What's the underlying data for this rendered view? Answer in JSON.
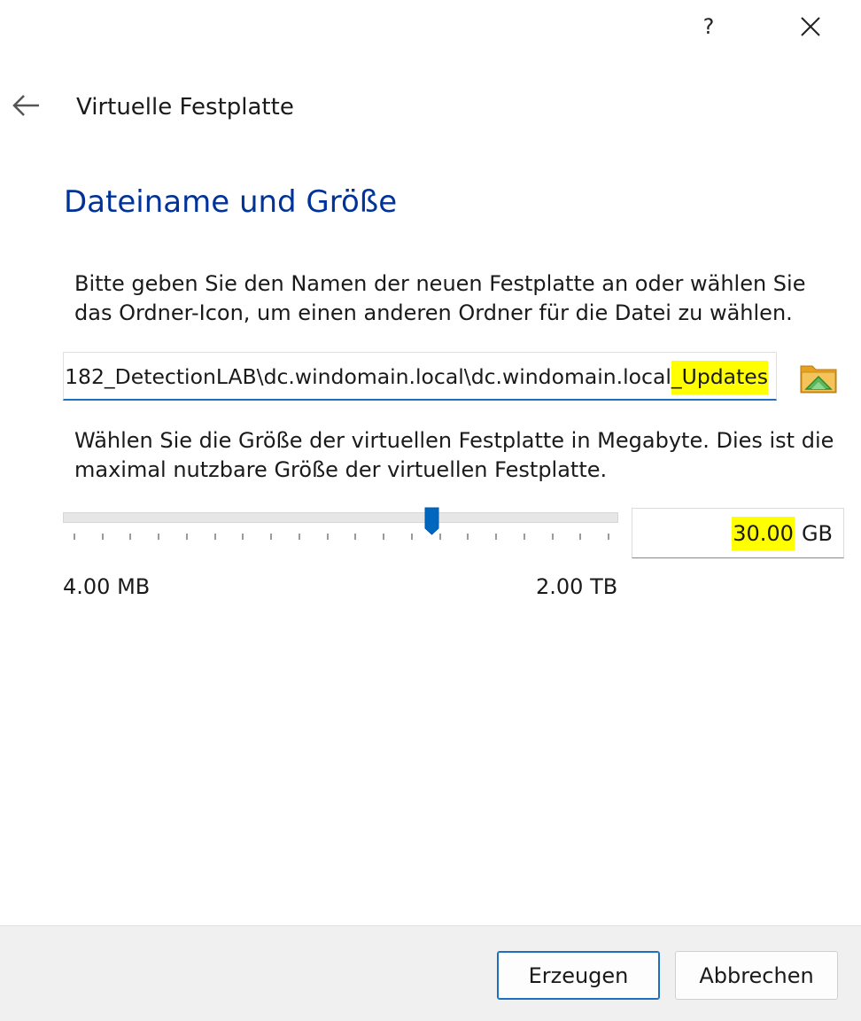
{
  "titlebar": {
    "help_label": "?",
    "close_icon": "close-icon"
  },
  "header": {
    "back_icon": "back-arrow-icon",
    "wizard_title": "Virtuelle Festplatte"
  },
  "page": {
    "title": "Dateiname und Größe",
    "filename_description": "Bitte geben Sie den Namen der neuen Festplatte an oder wählen Sie das Ordner-Icon, um einen anderen Ordner für die Datei zu wählen.",
    "filename": {
      "visible_prefix": "182_DetectionLAB\\dc.windomain.local\\dc.windomain.local",
      "highlighted_suffix": "_Updates",
      "highlight_color": "#ffff00"
    },
    "folder_icon": "folder-icon",
    "size_description": "Wählen Sie die Größe der virtuellen Festplatte in Megabyte. Dies ist die maximal nutzbare Größe der virtuellen Festplatte.",
    "size": {
      "slider_min_label": "4.00 MB",
      "slider_max_label": "2.00 TB",
      "slider_fraction": 0.67,
      "tick_count": 20,
      "value": "30.00",
      "unit": "GB"
    }
  },
  "footer": {
    "create_label": "Erzeugen",
    "cancel_label": "Abbrechen"
  },
  "colors": {
    "accent": "#1f6fbf",
    "title": "#003399",
    "highlight": "#ffff00",
    "footer_bg": "#f0f0f0"
  }
}
